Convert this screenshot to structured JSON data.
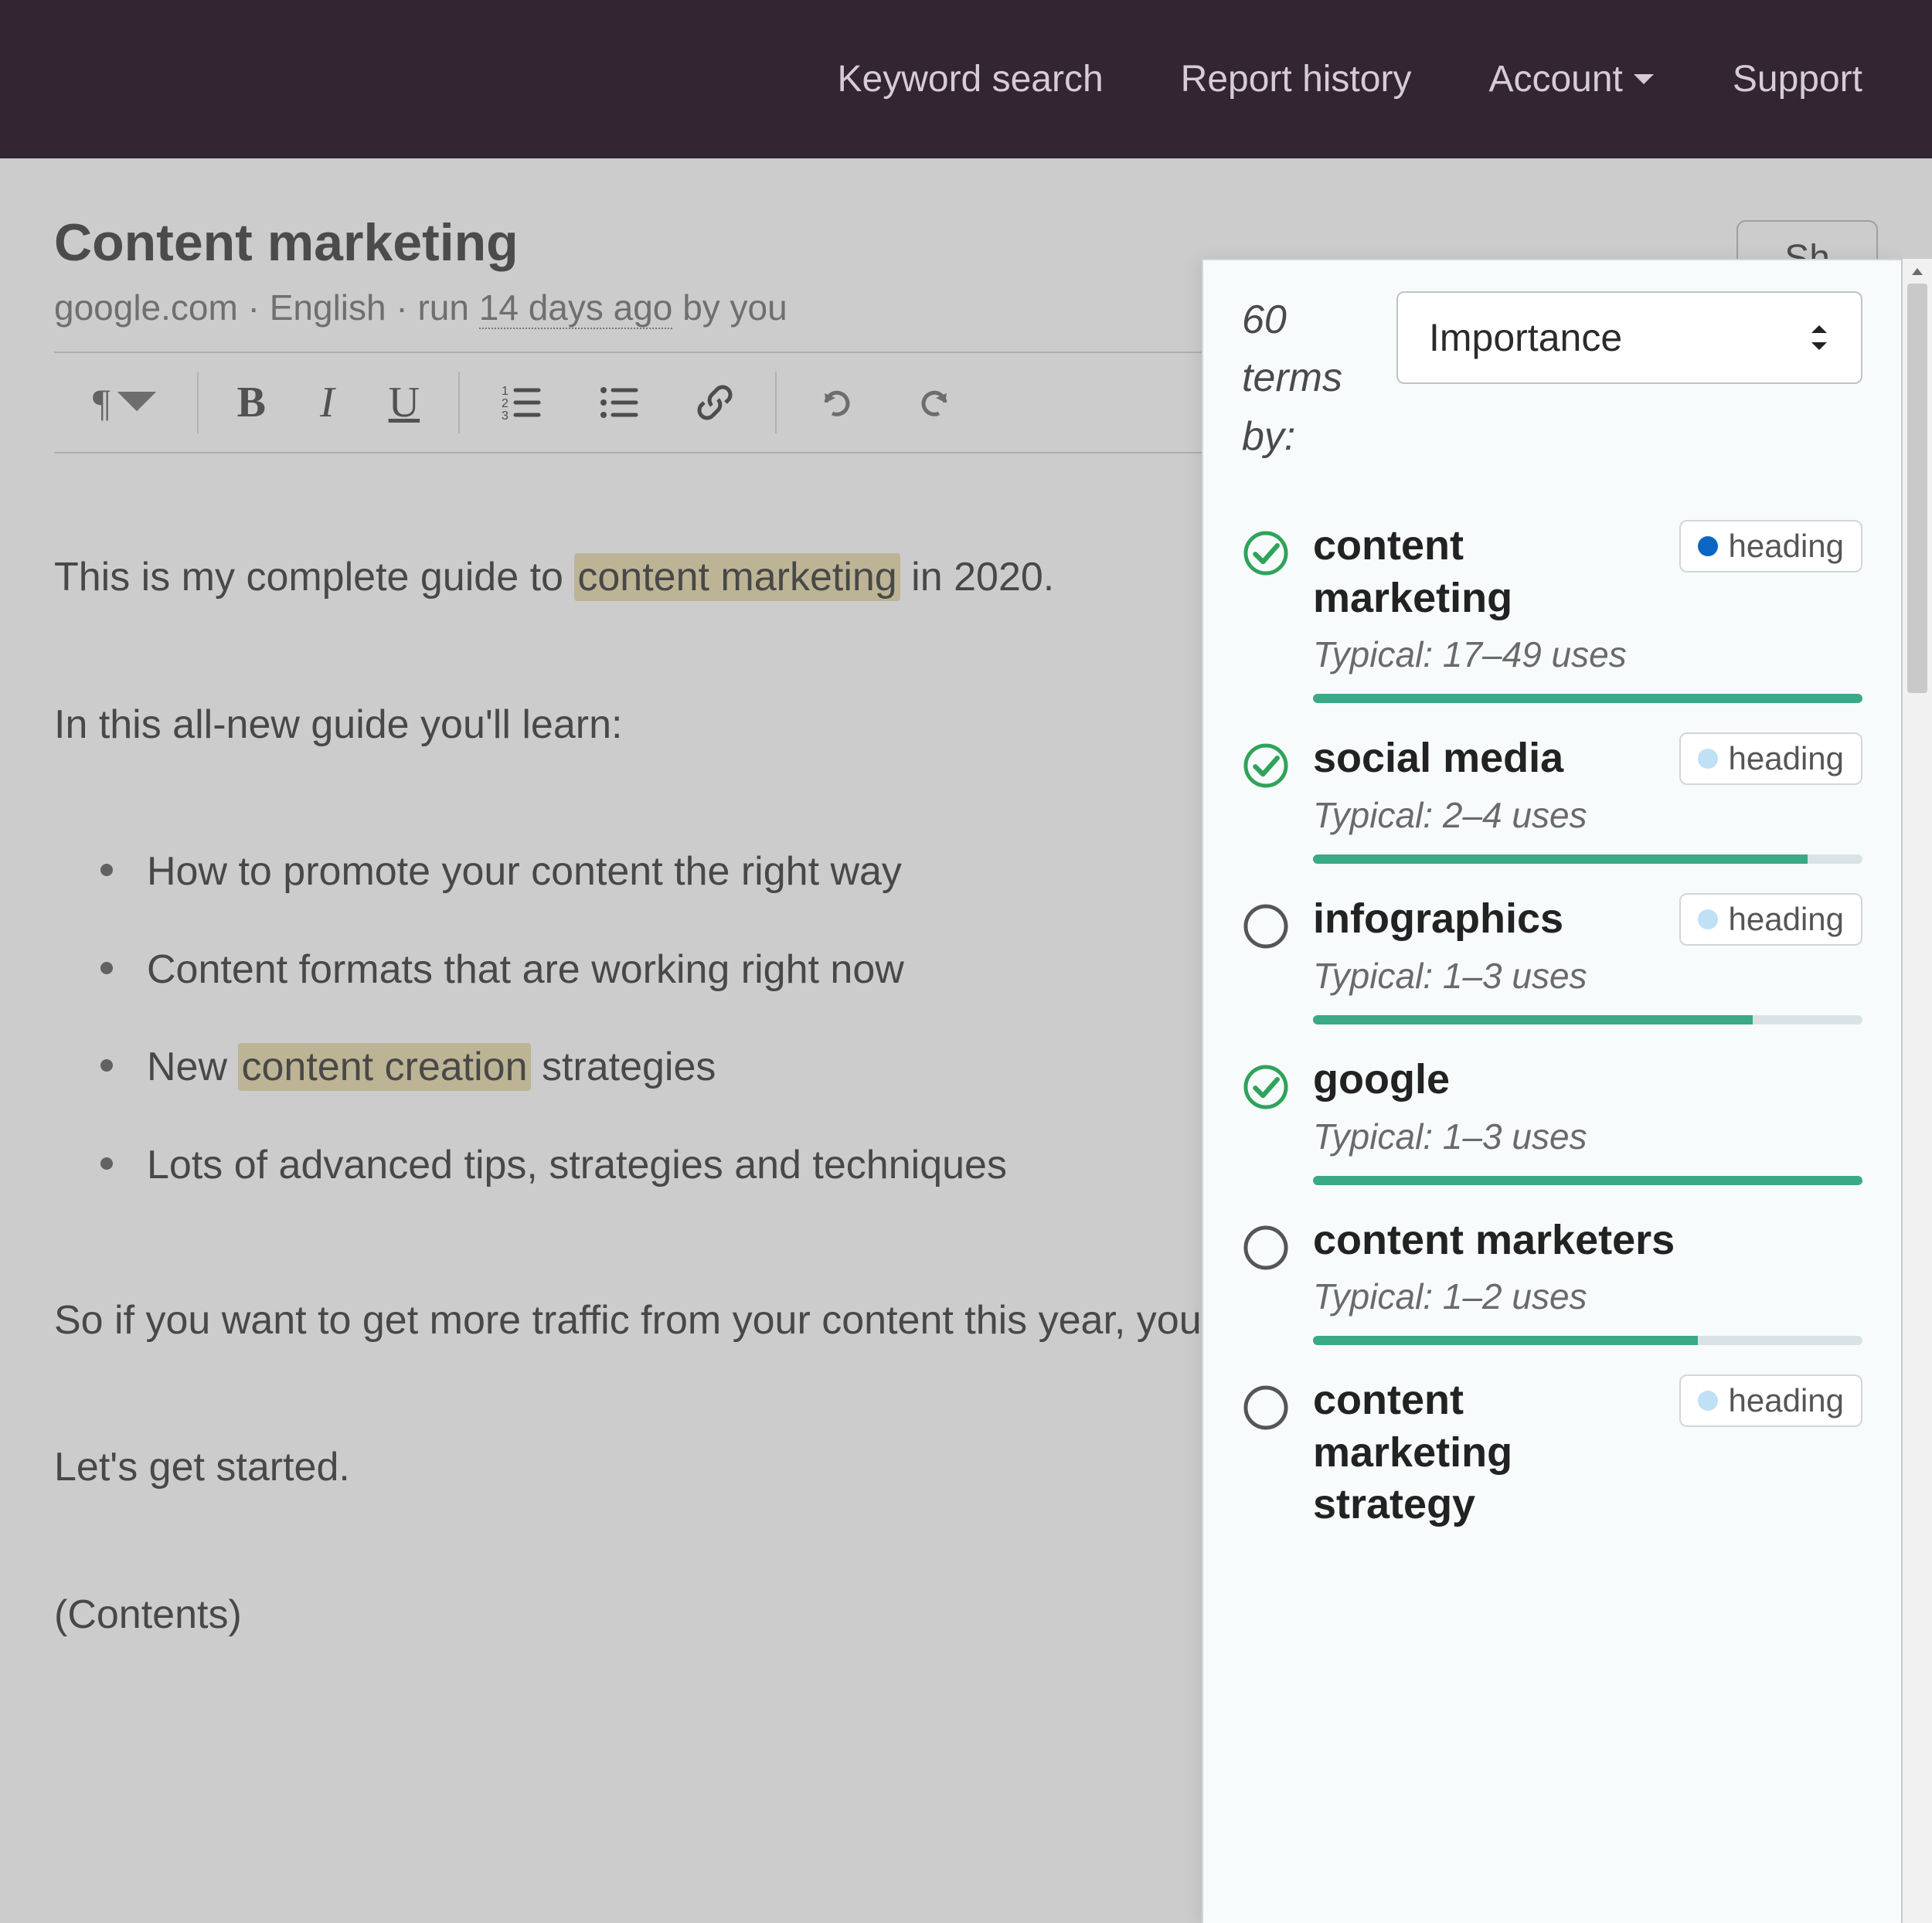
{
  "nav": {
    "keyword_search": "Keyword search",
    "report_history": "Report history",
    "account": "Account",
    "support": "Support"
  },
  "header": {
    "title": "Content marketing",
    "domain": "google.com",
    "language": "English",
    "run_prefix": "run",
    "run_age": "14 days ago",
    "run_suffix": "by you",
    "show_btn": "Sh"
  },
  "toolbar": {
    "paragraph_symbol": "¶",
    "bold": "B",
    "italic": "I",
    "underline": "U"
  },
  "editor": {
    "p1_a": "This is my complete guide to ",
    "p1_hl": "content marketing",
    "p1_b": " in 2020.",
    "p2": "In this all-new guide you'll learn:",
    "li1": "How to promote your content the right way",
    "li2": "Content formats that are working right now",
    "li3_a": "New ",
    "li3_hl": "content creation",
    "li3_b": " strategies",
    "li4": "Lots of advanced tips, strategies and techniques",
    "p3": "So if you want to get more traffic from your content this year, you'll love today's guide.",
    "p4": "Let's get started.",
    "p5": "(Contents)"
  },
  "panel": {
    "count": "60",
    "count_label_a": "terms",
    "count_label_b": "by:",
    "sort_value": "Importance",
    "badge_label": "heading",
    "typical_prefix": "Typical:",
    "terms": [
      {
        "label": "content marketing",
        "typical": "17–49 uses",
        "status": "check",
        "badge": "dark",
        "fill": 100
      },
      {
        "label": "social media",
        "typical": "2–4 uses",
        "status": "check",
        "badge": "light",
        "fill": 90
      },
      {
        "label": "infographics",
        "typical": "1–3 uses",
        "status": "empty",
        "badge": "light",
        "fill": 80
      },
      {
        "label": "google",
        "typical": "1–3 uses",
        "status": "check",
        "badge": null,
        "fill": 100
      },
      {
        "label": "content marketers",
        "typical": "1–2 uses",
        "status": "empty",
        "badge": null,
        "fill": 70
      },
      {
        "label": "content marketing strategy",
        "typical": "",
        "status": "empty",
        "badge": "light",
        "fill": 0
      }
    ]
  }
}
